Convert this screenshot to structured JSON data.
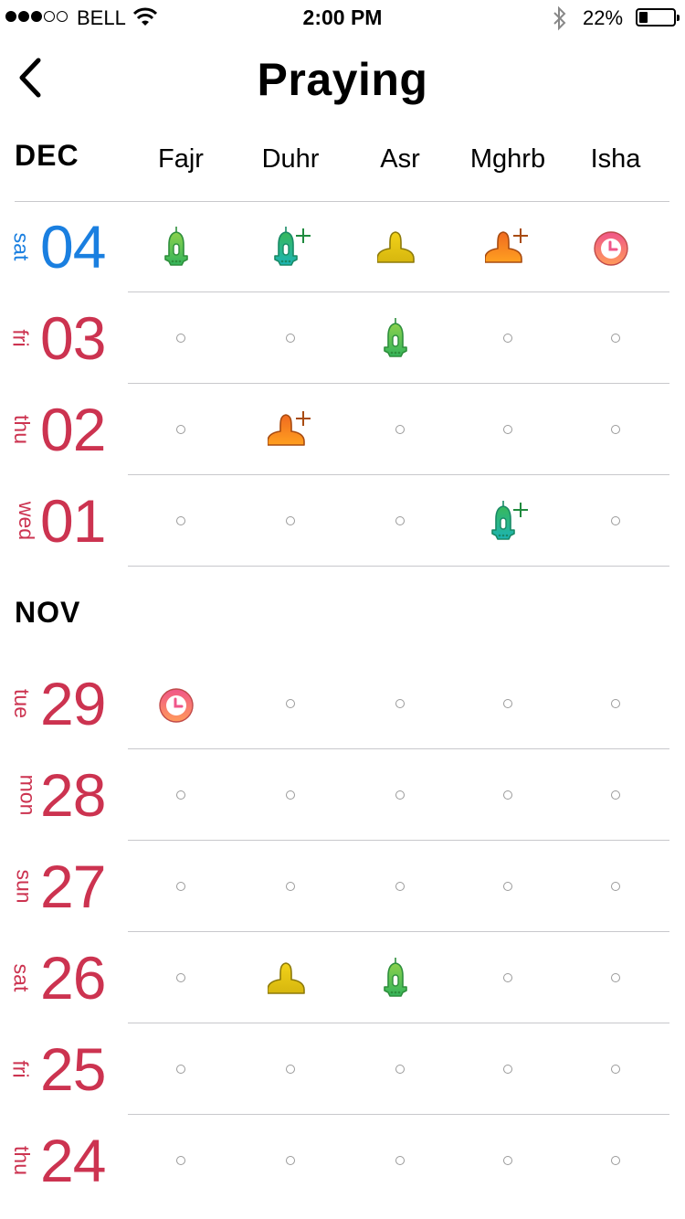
{
  "status": {
    "carrier": "BELL",
    "time": "2:00 PM",
    "battery": "22%",
    "battery_level": 0.22
  },
  "nav": {
    "title": "Praying"
  },
  "columns": [
    "Fajr",
    "Duhr",
    "Asr",
    "Mghrb",
    "Isha"
  ],
  "colors": {
    "today": "#1a7fe0",
    "past": "#cc3350",
    "separator": "#c8c8cc"
  },
  "sections": [
    {
      "month": "DEC",
      "rows": [
        {
          "dow": "sat",
          "day": "04",
          "today": true,
          "prayers": [
            "mosque-icon",
            "mosque-late-icon",
            "alone-icon",
            "alone-late-icon",
            "missed-clock-icon"
          ]
        },
        {
          "dow": "fri",
          "day": "03",
          "today": false,
          "prayers": [
            "none",
            "none",
            "mosque-icon",
            "none",
            "none"
          ]
        },
        {
          "dow": "thu",
          "day": "02",
          "today": false,
          "prayers": [
            "none",
            "alone-late-icon",
            "none",
            "none",
            "none"
          ]
        },
        {
          "dow": "wed",
          "day": "01",
          "today": false,
          "prayers": [
            "none",
            "none",
            "none",
            "mosque-late-icon",
            "none"
          ]
        }
      ]
    },
    {
      "month": "NOV",
      "rows": [
        {
          "dow": "tue",
          "day": "29",
          "today": false,
          "prayers": [
            "missed-clock-icon",
            "none",
            "none",
            "none",
            "none"
          ]
        },
        {
          "dow": "mon",
          "day": "28",
          "today": false,
          "prayers": [
            "none",
            "none",
            "none",
            "none",
            "none"
          ]
        },
        {
          "dow": "sun",
          "day": "27",
          "today": false,
          "prayers": [
            "none",
            "none",
            "none",
            "none",
            "none"
          ]
        },
        {
          "dow": "sat",
          "day": "26",
          "today": false,
          "prayers": [
            "none",
            "alone-icon",
            "mosque-icon",
            "none",
            "none"
          ]
        },
        {
          "dow": "fri",
          "day": "25",
          "today": false,
          "prayers": [
            "none",
            "none",
            "none",
            "none",
            "none"
          ]
        },
        {
          "dow": "thu",
          "day": "24",
          "today": false,
          "prayers": [
            "none",
            "none",
            "none",
            "none",
            "none"
          ]
        }
      ]
    }
  ]
}
